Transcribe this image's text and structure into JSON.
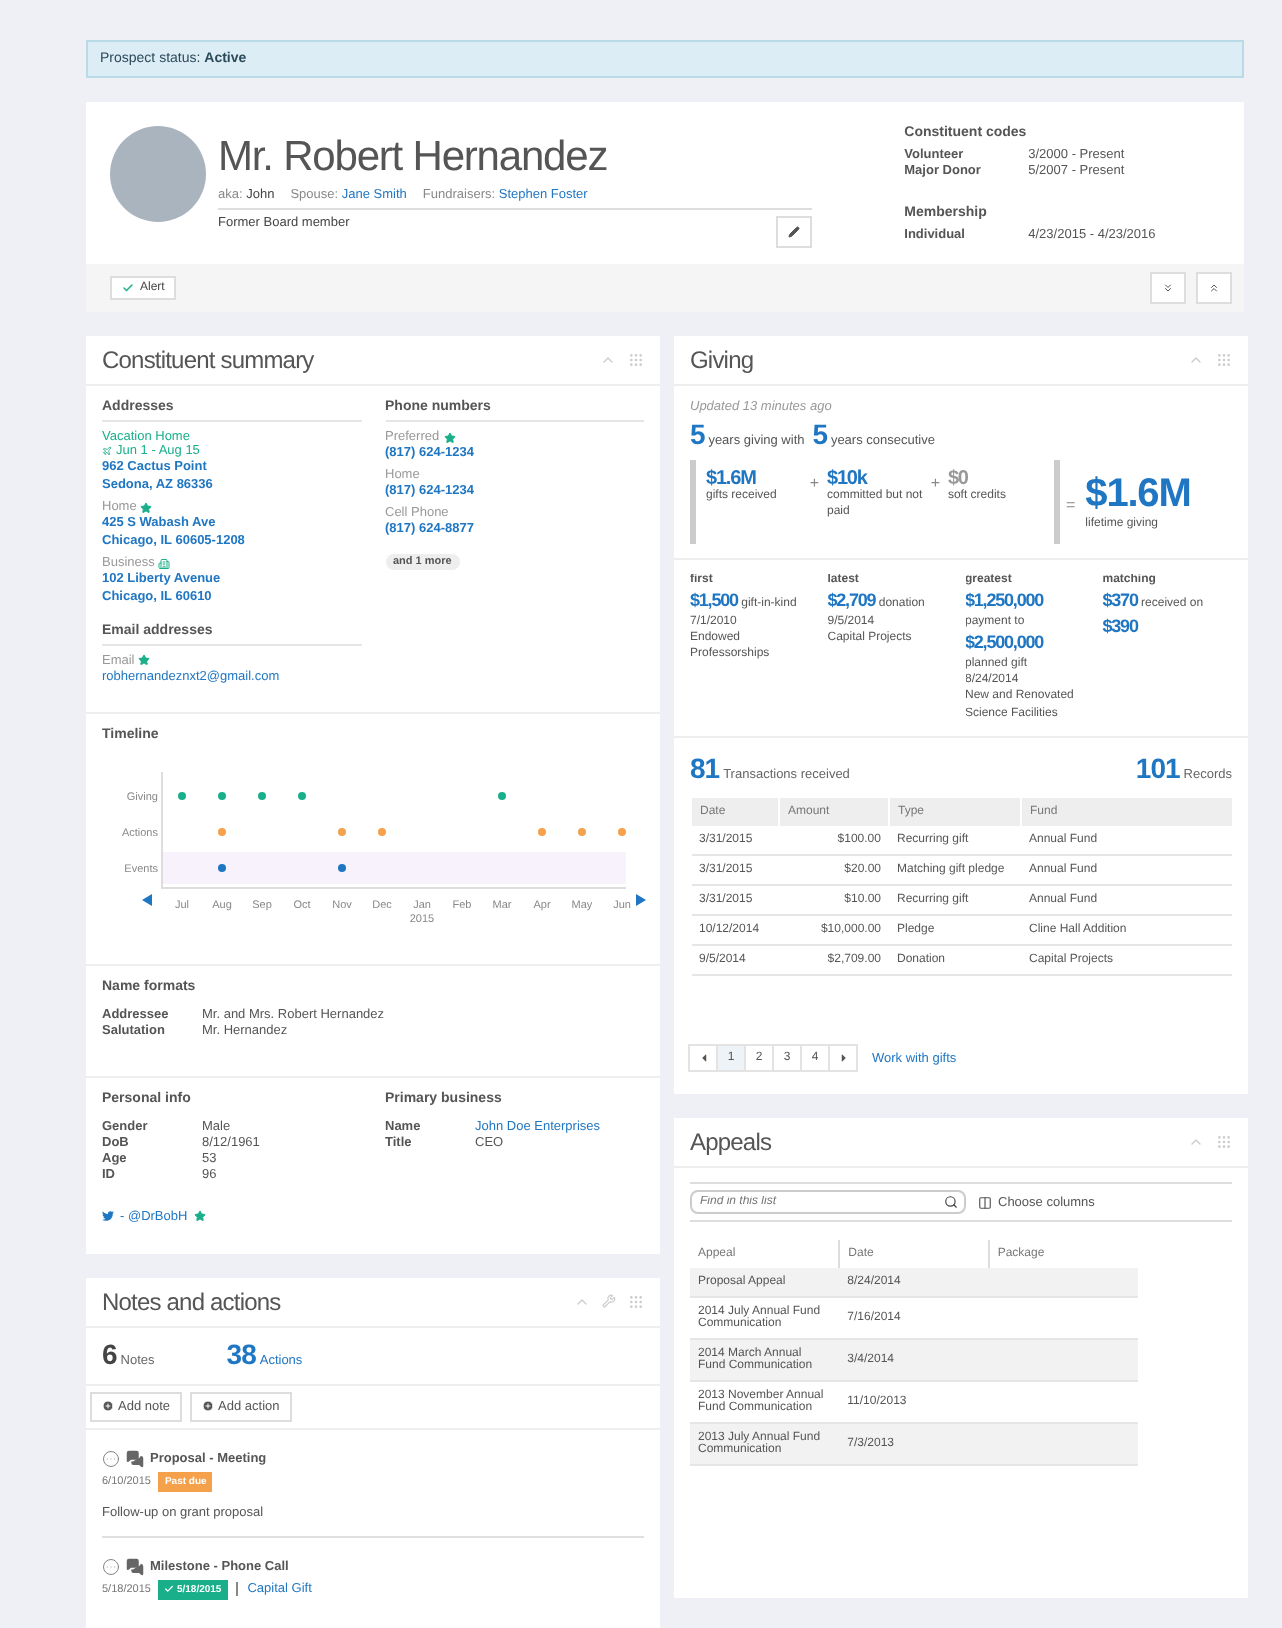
{
  "prospect_status": {
    "label": "Prospect status:",
    "value": "Active"
  },
  "profile": {
    "name": "Mr. Robert Hernandez",
    "details": [
      {
        "label": "aka:",
        "value": "John",
        "kind": "text"
      },
      {
        "label": "Spouse:",
        "value": "Jane Smith",
        "kind": "link"
      },
      {
        "label": "Fundraisers:",
        "value": "Stephen Foster",
        "kind": "link"
      }
    ],
    "note": "Former Board member",
    "info_groups": [
      {
        "title": "Constituent codes",
        "rows": [
          {
            "label": "Volunteer",
            "value": "3/2000 - Present"
          },
          {
            "label": "Major Donor",
            "value": "5/2007 - Present"
          }
        ]
      },
      {
        "title": "Membership",
        "rows": [
          {
            "label": "Individual",
            "value": "4/23/2015 - 4/23/2016"
          }
        ]
      }
    ],
    "alert_button": "Alert"
  },
  "constituent_summary": {
    "title": "Constituent summary",
    "addresses": {
      "title": "Addresses",
      "items": [
        {
          "kind": "seasonal",
          "type": "Vacation Home",
          "dates": "Jun 1 - Aug 15",
          "lines": [
            "962 Cactus Point",
            "Sedona, AZ 86336"
          ],
          "primary": false
        },
        {
          "kind": "home",
          "type": "Home",
          "lines": [
            "425 S Wabash Ave",
            "Chicago, IL 60605-1208"
          ],
          "primary": true
        },
        {
          "kind": "business",
          "type": "Business",
          "lines": [
            "102 Liberty Avenue",
            "Chicago, IL 60610"
          ],
          "primary": false
        }
      ]
    },
    "phones": {
      "title": "Phone numbers",
      "items": [
        {
          "label": "Preferred",
          "number": "(817) 624-1234",
          "primary": true
        },
        {
          "label": "Home",
          "number": "(817) 624-1234",
          "primary": false
        },
        {
          "label": "Cell Phone",
          "number": "(817) 624-8877",
          "primary": false
        }
      ],
      "more": "and 1 more"
    },
    "emails": {
      "title": "Email addresses",
      "items": [
        {
          "label": "Email",
          "address": "robhernandeznxt2@gmail.com",
          "primary": true
        }
      ]
    },
    "timeline": {
      "title": "Timeline",
      "months": [
        {
          "label": "Jul"
        },
        {
          "label": "Aug"
        },
        {
          "label": "Sep"
        },
        {
          "label": "Oct"
        },
        {
          "label": "Nov"
        },
        {
          "label": "Dec"
        },
        {
          "label": "Jan",
          "year": "2015"
        },
        {
          "label": "Feb"
        },
        {
          "label": "Mar"
        },
        {
          "label": "Apr"
        },
        {
          "label": "May"
        },
        {
          "label": "Jun"
        }
      ],
      "rows": [
        {
          "name": "Giving",
          "color": "#1aaf8b",
          "active": [
            true,
            true,
            true,
            true,
            false,
            false,
            false,
            false,
            true,
            false,
            false,
            false
          ]
        },
        {
          "name": "Actions",
          "color": "#f5a14b",
          "active": [
            false,
            true,
            false,
            false,
            true,
            true,
            false,
            false,
            false,
            true,
            true,
            true
          ]
        },
        {
          "name": "Events",
          "color": "#1f76c2",
          "active": [
            false,
            true,
            false,
            false,
            true,
            false,
            false,
            false,
            false,
            false,
            false,
            false
          ]
        }
      ]
    },
    "name_formats": {
      "title": "Name formats",
      "rows": [
        {
          "label": "Addressee",
          "value": "Mr. and Mrs. Robert Hernandez"
        },
        {
          "label": "Salutation",
          "value": "Mr. Hernandez"
        }
      ]
    },
    "personal_info": {
      "title": "Personal info",
      "rows": [
        {
          "label": "Gender",
          "value": "Male"
        },
        {
          "label": "DoB",
          "value": "8/12/1961"
        },
        {
          "label": "Age",
          "value": "53"
        },
        {
          "label": "ID",
          "value": "96"
        }
      ]
    },
    "primary_business": {
      "title": "Primary business",
      "rows": [
        {
          "label": "Name",
          "value": "John Doe Enterprises",
          "link": true
        },
        {
          "label": "Title",
          "value": "CEO",
          "link": false
        }
      ]
    },
    "social": {
      "handle": "- @DrBobH",
      "primary": true
    }
  },
  "notes_and_actions": {
    "title": "Notes and actions",
    "counts": [
      {
        "count": "6",
        "label": "Notes",
        "link": false
      },
      {
        "count": "38",
        "label": "Actions",
        "link": true
      }
    ],
    "buttons": [
      "Add note",
      "Add action"
    ],
    "items": [
      {
        "title": "Proposal - Meeting",
        "date": "6/10/2015",
        "status": {
          "kind": "past_due",
          "text": "Past due"
        },
        "description": "Follow-up on grant proposal"
      },
      {
        "title": "Milestone - Phone Call",
        "date": "5/18/2015",
        "status": {
          "kind": "completed",
          "text": "5/18/2015"
        },
        "link": "Capital Gift"
      }
    ]
  },
  "giving": {
    "title": "Giving",
    "updated": "Updated 13 minutes ago",
    "years": [
      {
        "count": "5",
        "label": "years giving with"
      },
      {
        "count": "5",
        "label": "years consecutive"
      }
    ],
    "terms": [
      {
        "amount": "$1.6M",
        "label": "gifts received",
        "muted": false
      },
      {
        "operator": "+",
        "amount": "$10k",
        "label": "committed but not paid",
        "muted": false
      },
      {
        "operator": "+",
        "amount": "$0",
        "label": "soft credits",
        "muted": true
      }
    ],
    "total": {
      "operator": "=",
      "amount": "$1.6M",
      "label": "lifetime giving"
    },
    "highlights": [
      {
        "title": "first",
        "lines": [
          {
            "amount": "$1,500",
            "text": "gift-in-kind"
          },
          {
            "text": "7/1/2010"
          },
          {
            "text": "Endowed Professorships"
          }
        ]
      },
      {
        "title": "latest",
        "lines": [
          {
            "amount": "$2,709",
            "text": "donation"
          },
          {
            "text": "9/5/2014"
          },
          {
            "text": "Capital Projects"
          }
        ]
      },
      {
        "title": "greatest",
        "lines": [
          {
            "amount": "$1,250,000"
          },
          {
            "text": "payment to"
          },
          {
            "amount": "$2,500,000"
          },
          {
            "text": "planned gift"
          },
          {
            "text": "8/24/2014"
          },
          {
            "text": "New and Renovated Science Facilities"
          }
        ]
      },
      {
        "title": "matching",
        "lines": [
          {
            "amount": "$370",
            "text": "received on"
          },
          {
            "amount": "$390"
          }
        ]
      }
    ],
    "transactions": {
      "count": "81",
      "label": "Transactions received"
    },
    "records": {
      "count": "101",
      "label": "Records"
    },
    "table": {
      "columns": [
        "Date",
        "Amount",
        "Type",
        "Fund"
      ],
      "rows": [
        [
          "3/31/2015",
          "$100.00",
          "Recurring gift",
          "Annual Fund"
        ],
        [
          "3/31/2015",
          "$20.00",
          "Matching gift pledge",
          "Annual Fund"
        ],
        [
          "3/31/2015",
          "$10.00",
          "Recurring gift",
          "Annual Fund"
        ],
        [
          "10/12/2014",
          "$10,000.00",
          "Pledge",
          "Cline Hall Addition"
        ],
        [
          "9/5/2014",
          "$2,709.00",
          "Donation",
          "Capital Projects"
        ]
      ]
    },
    "pages": [
      {
        "label": "1",
        "selected": true
      },
      {
        "label": "2",
        "selected": false
      },
      {
        "label": "3",
        "selected": false
      },
      {
        "label": "4",
        "selected": false
      }
    ],
    "work_link": "Work with gifts"
  },
  "appeals": {
    "title": "Appeals",
    "search": {
      "placeholder": "Find in this list"
    },
    "choose_columns": "Choose columns",
    "columns": [
      "Appeal",
      "Date",
      "Package"
    ],
    "rows": [
      [
        "Proposal Appeal",
        "8/24/2014"
      ],
      [
        "2014 July Annual Fund Communication",
        "7/16/2014"
      ],
      [
        "2014 March Annual Fund Communication",
        "3/4/2014"
      ],
      [
        "2013 November Annual Fund Communication",
        "11/10/2013"
      ],
      [
        "2013 July Annual Fund Communication",
        "7/3/2013"
      ]
    ]
  }
}
